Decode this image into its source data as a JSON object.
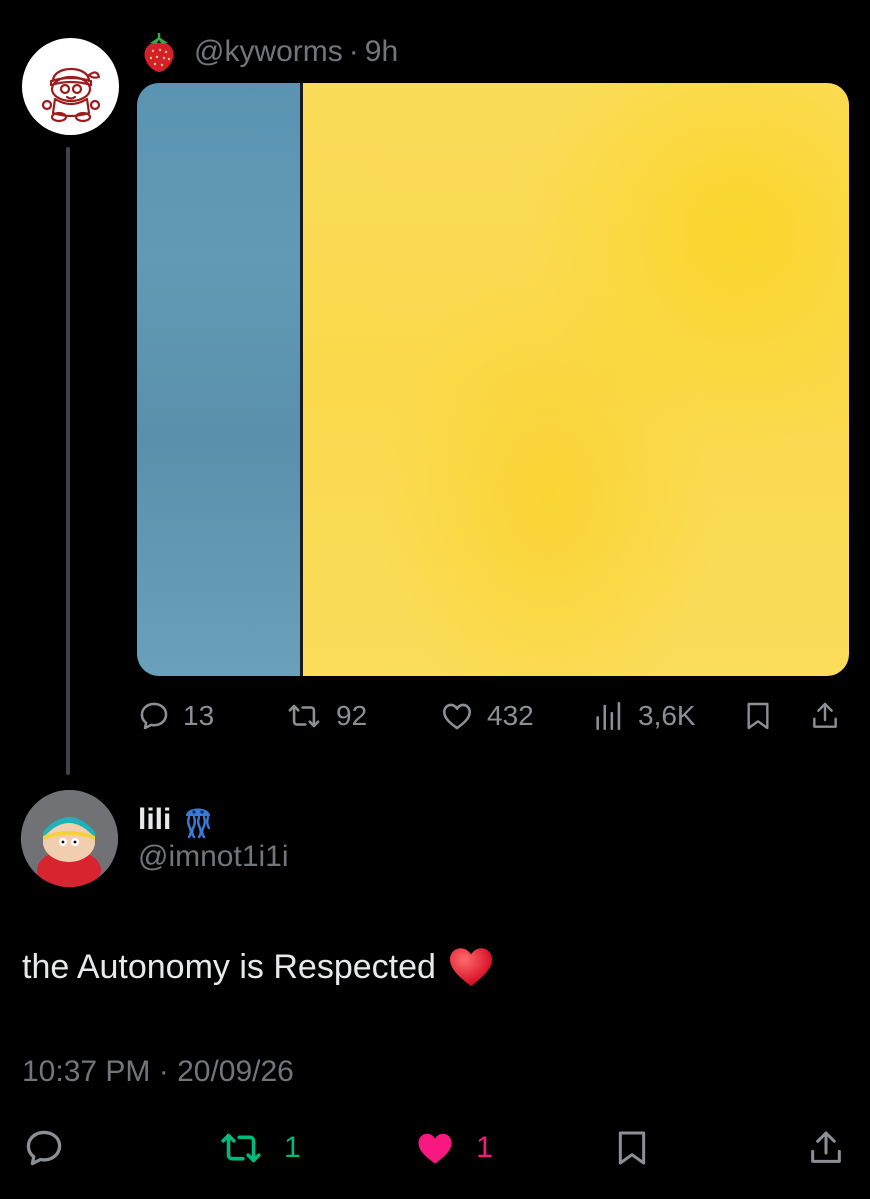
{
  "quoted_post": {
    "handle": "@kyworms",
    "separator": "·",
    "time": "9h",
    "avatar_icon": "cartoon-character-icon",
    "handle_emoji_icon": "strawberry-icon",
    "media_colors": {
      "left": "#6199b6",
      "right": "#fad94c"
    },
    "stats": {
      "replies": "13",
      "reposts": "92",
      "likes": "432",
      "views": "3,6K"
    }
  },
  "reply_post": {
    "display_name": "lili",
    "name_emoji_icon": "jellyfish-icon",
    "handle": "@imnot1i1i",
    "text": "the Autonomy is Respected",
    "text_emoji_icon": "red-heart-icon",
    "timestamp": "10:37 PM · 20/09/26",
    "actions": {
      "reposts": "1",
      "likes": "1"
    }
  },
  "colors": {
    "background": "#000000",
    "repost_active": "#00ba7c",
    "like_active": "#f91880",
    "muted": "#71767b"
  }
}
